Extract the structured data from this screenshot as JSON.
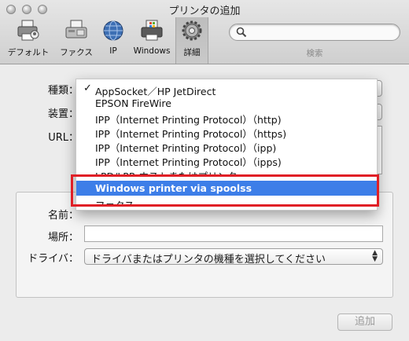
{
  "window": {
    "title": "プリンタの追加"
  },
  "toolbar": {
    "items": [
      {
        "label": "デフォルト",
        "icon": "default-printer-icon"
      },
      {
        "label": "ファクス",
        "icon": "fax-icon"
      },
      {
        "label": "IP",
        "icon": "ip-globe-icon"
      },
      {
        "label": "Windows",
        "icon": "windows-printer-icon"
      },
      {
        "label": "詳細",
        "icon": "advanced-gear-icon",
        "active": true
      }
    ],
    "search": {
      "placeholder": "",
      "label": "検索"
    }
  },
  "form": {
    "type_label": "種類：",
    "device_label": "装置：",
    "url_label": "URL：",
    "name_label": "名前：",
    "location_label": "場所：",
    "driver_label": "ドライバ：",
    "driver_value": "ドライバまたはプリンタの機種を選択してください",
    "add_button": "追加"
  },
  "menu": {
    "items": [
      {
        "label": "AppSocket／HP JetDirect",
        "checked": true
      },
      {
        "label": "EPSON FireWire"
      },
      {
        "label": "IPP（Internet Printing Protocol）（http)"
      },
      {
        "label": "IPP（Internet Printing Protocol）（https)"
      },
      {
        "label": "IPP（Internet Printing Protocol）（ipp)"
      },
      {
        "label": "IPP（Internet Printing Protocol）（ipps)"
      },
      {
        "label": "LPD/LPR ホストまたはプリンタ",
        "partial": true
      },
      {
        "label": "Windows printer via spoolss",
        "selected": true
      },
      {
        "label": "ファクス",
        "partial": true
      }
    ]
  },
  "colors": {
    "selection": "#3d7ee8",
    "highlight_frame": "#e01f26"
  }
}
